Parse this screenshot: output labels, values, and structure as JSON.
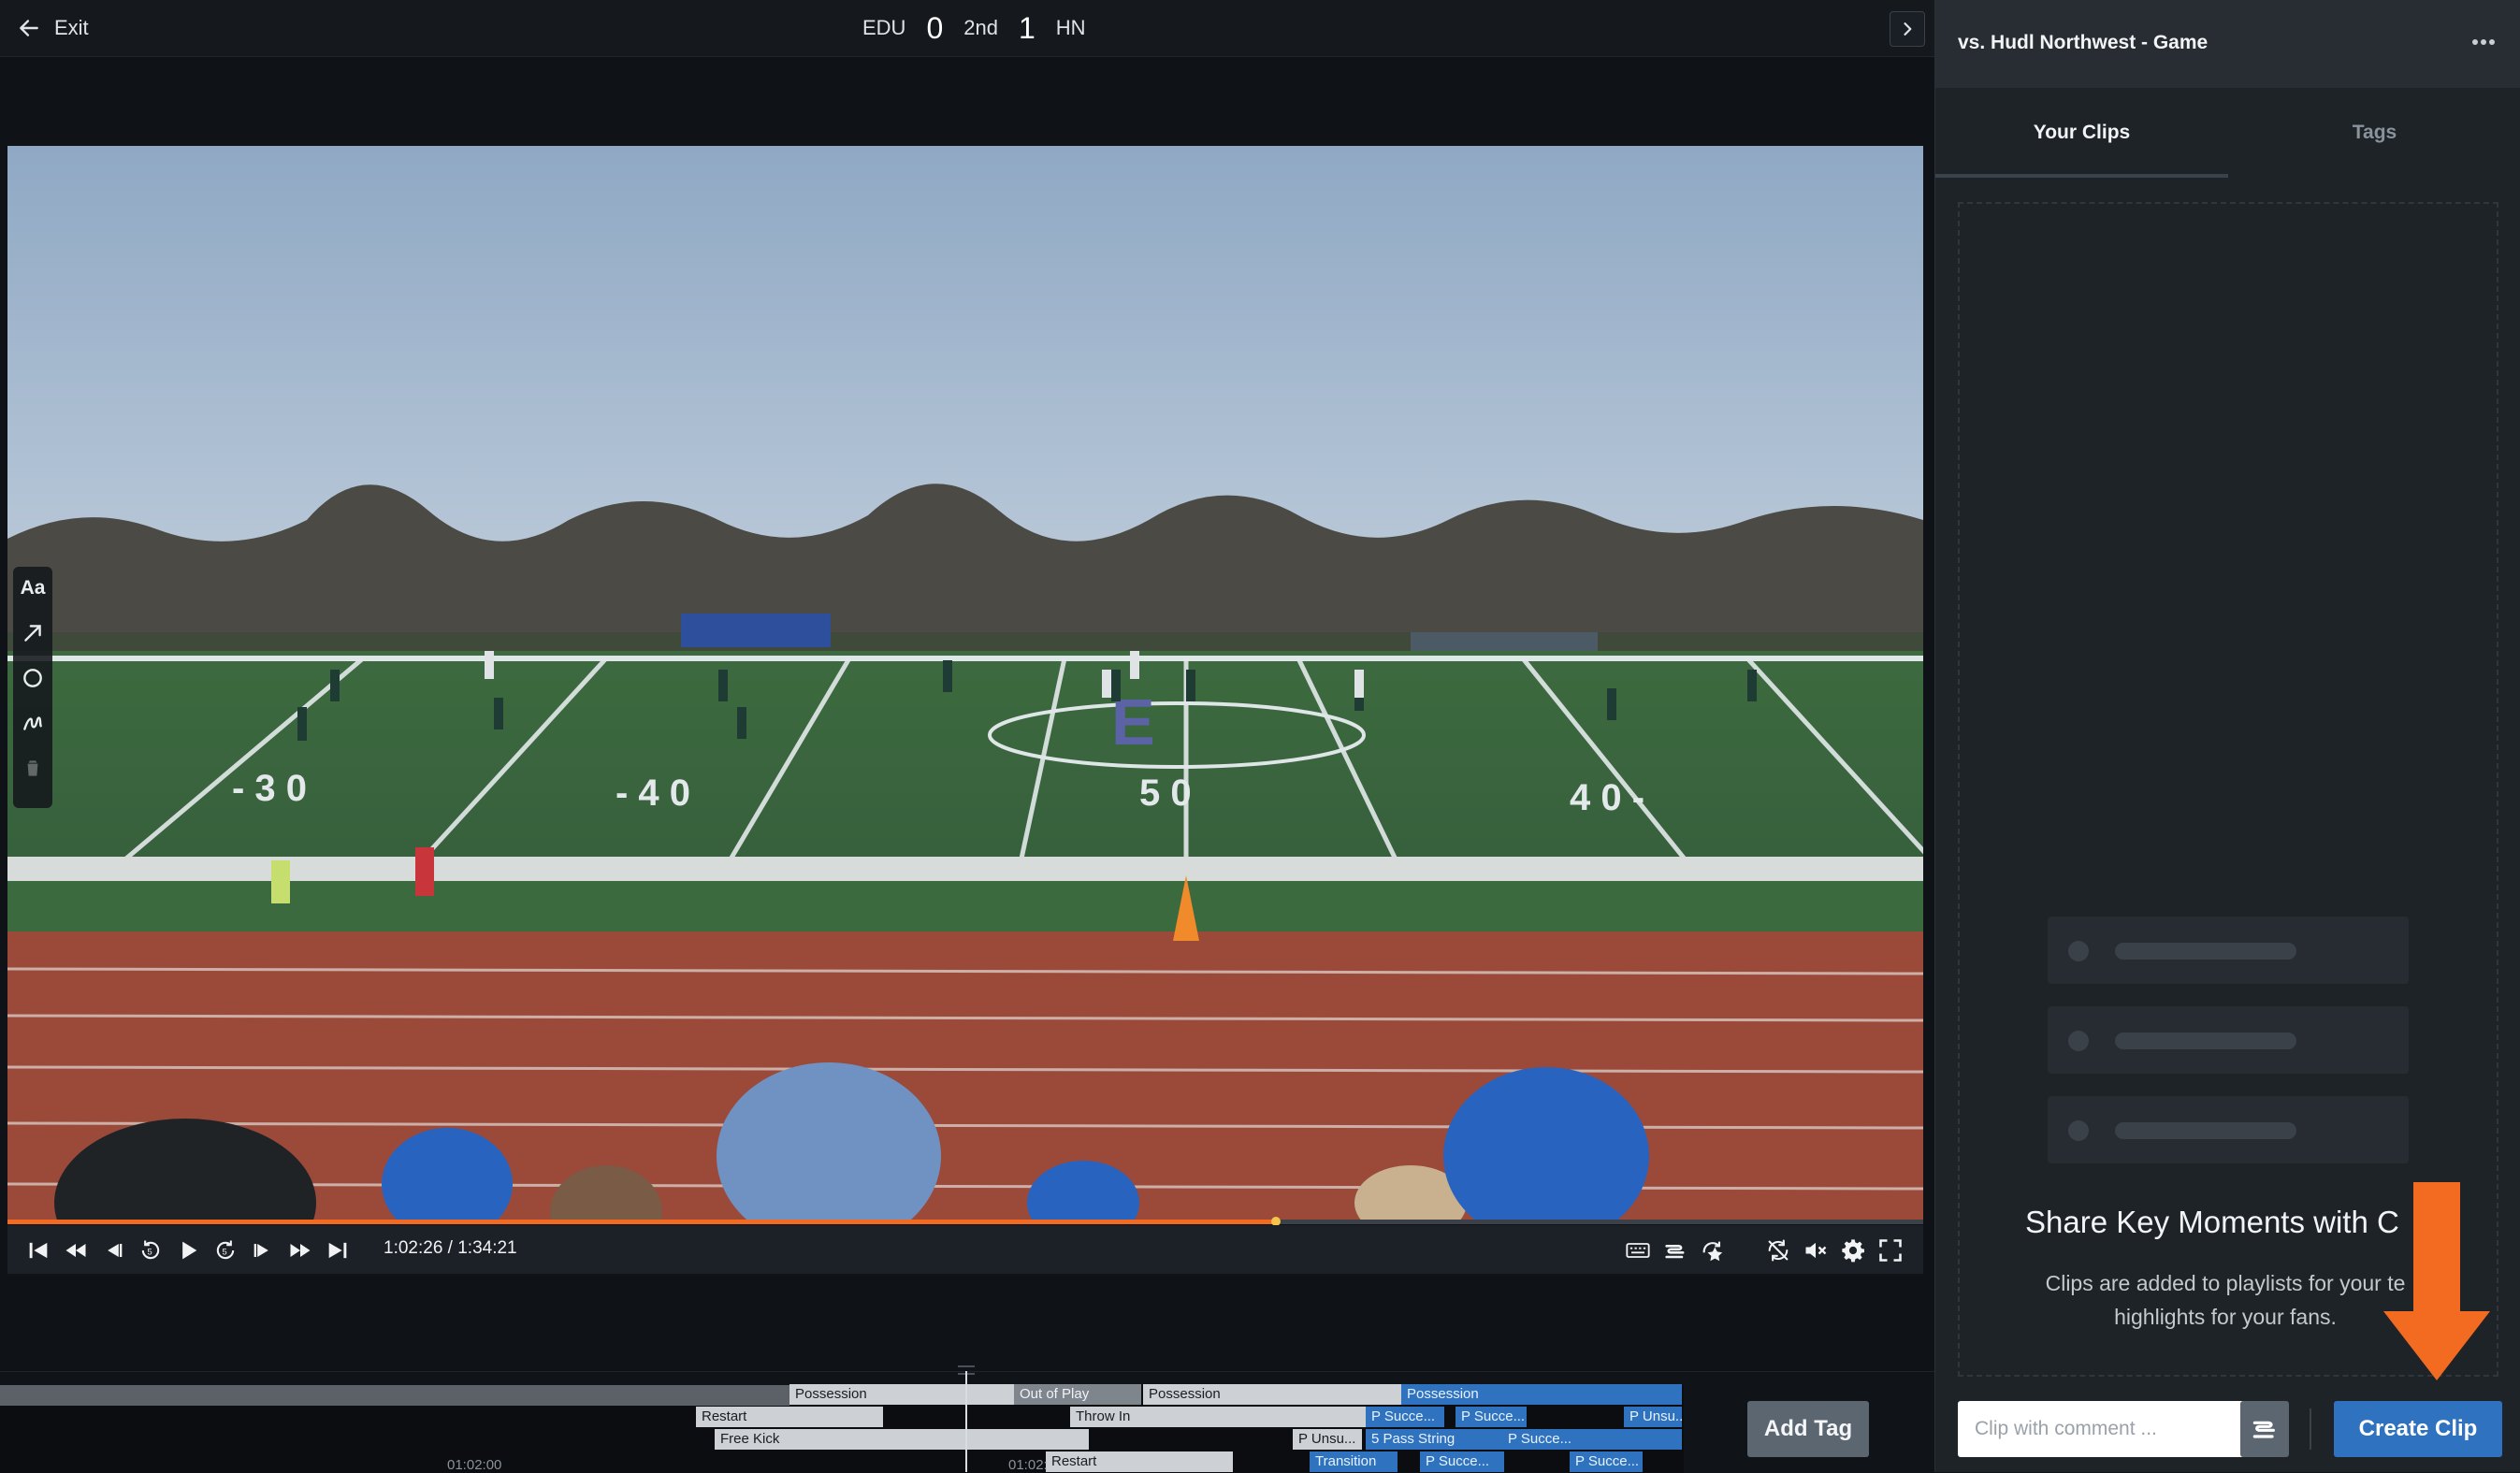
{
  "header": {
    "exit_label": "Exit",
    "home_team": "EDU",
    "home_score": "0",
    "period": "2nd",
    "away_score": "1",
    "away_team": "HN"
  },
  "player": {
    "timecode": "1:02:26 / 1:34:21",
    "progress": 0.662,
    "draw_tools": {
      "text_label": "Aa"
    }
  },
  "timeline": {
    "ticks": [
      "01:02:00",
      "01:02:"
    ],
    "add_tag_label": "Add Tag",
    "rows": [
      [
        {
          "label": "Possession",
          "color": "light"
        },
        {
          "label": "Out of Play",
          "color": "gray"
        },
        {
          "label": "Possession",
          "color": "light"
        },
        {
          "label": "Possession",
          "color": "blue"
        }
      ],
      [
        {
          "label": "Restart",
          "color": "light"
        },
        {
          "label": "Throw In",
          "color": "light"
        },
        {
          "label": "P Succe...",
          "color": "blue"
        },
        {
          "label": "P Succe...",
          "color": "blue"
        },
        {
          "label": "P Unsu...",
          "color": "blue"
        }
      ],
      [
        {
          "label": "Free Kick",
          "color": "light"
        },
        {
          "label": "P Unsu...",
          "color": "light"
        },
        {
          "label": "5 Pass String",
          "color": "blue"
        },
        {
          "label": "P Succe...",
          "color": "blue"
        }
      ],
      [
        {
          "label": "Restart",
          "color": "light"
        },
        {
          "label": "Transition",
          "color": "blue"
        },
        {
          "label": "P Succe...",
          "color": "blue"
        },
        {
          "label": "P Succe...",
          "color": "blue"
        }
      ]
    ]
  },
  "panel": {
    "title": "vs. Hudl Northwest - Game",
    "tabs": [
      "Your Clips",
      "Tags"
    ],
    "empty_title": "Share Key Moments with C",
    "empty_line1": "Clips are added to playlists for your te",
    "empty_line2": "highlights for your fans.",
    "comment_placeholder": "Clip with comment ...",
    "create_clip_label": "Create Clip"
  },
  "colors": {
    "accent_orange": "#f26b21",
    "brand_blue": "#2f73c0",
    "panel_bg": "#1e2328"
  }
}
